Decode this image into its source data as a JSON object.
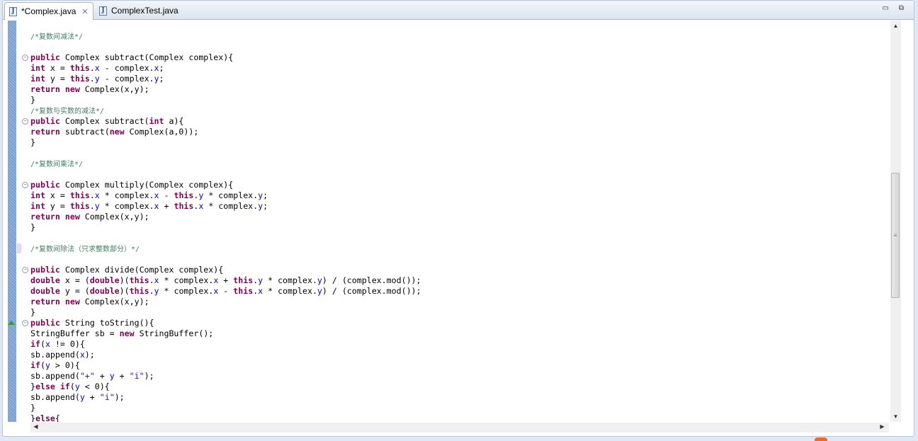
{
  "tabs": [
    {
      "label": "*Complex.java",
      "active": true,
      "icon": "java-file-icon"
    },
    {
      "label": "ComplexTest.java",
      "active": false,
      "icon": "java-file-icon"
    }
  ],
  "window_controls": {
    "minimize": "▭",
    "maximize": "⧉"
  },
  "colors": {
    "keyword": "#7f0055",
    "field": "#0000c0",
    "string": "#2a00ff",
    "comment": "#3f7f5f"
  },
  "scroll": {
    "vertical_position_percent": 41
  },
  "code_lines": [
    [],
    [
      [
        "c",
        "/*复数间减法*/"
      ]
    ],
    [],
    [
      [
        "k",
        "public"
      ],
      [
        "p",
        " Complex subtract(Complex complex){"
      ]
    ],
    [
      [
        "k",
        "int"
      ],
      [
        "p",
        " x = "
      ],
      [
        "k",
        "this"
      ],
      [
        "p",
        "."
      ],
      [
        "f",
        "x"
      ],
      [
        "p",
        " - complex."
      ],
      [
        "f",
        "x"
      ],
      [
        "p",
        ";"
      ]
    ],
    [
      [
        "k",
        "int"
      ],
      [
        "p",
        " y = "
      ],
      [
        "k",
        "this"
      ],
      [
        "p",
        "."
      ],
      [
        "f",
        "y"
      ],
      [
        "p",
        " - complex."
      ],
      [
        "f",
        "y"
      ],
      [
        "p",
        ";"
      ]
    ],
    [
      [
        "k",
        "return"
      ],
      [
        "p",
        " "
      ],
      [
        "k",
        "new"
      ],
      [
        "p",
        " Complex(x,y);"
      ]
    ],
    [
      [
        "p",
        "}"
      ]
    ],
    [
      [
        "c",
        "/*复数与实数的减法*/"
      ]
    ],
    [
      [
        "k",
        "public"
      ],
      [
        "p",
        " Complex subtract("
      ],
      [
        "k",
        "int"
      ],
      [
        "p",
        " a){"
      ]
    ],
    [
      [
        "k",
        "return"
      ],
      [
        "p",
        " subtract("
      ],
      [
        "k",
        "new"
      ],
      [
        "p",
        " Complex(a,0));"
      ]
    ],
    [
      [
        "p",
        "}"
      ]
    ],
    [],
    [
      [
        "c",
        "/*复数间乘法*/"
      ]
    ],
    [],
    [
      [
        "k",
        "public"
      ],
      [
        "p",
        " Complex multiply(Complex complex){"
      ]
    ],
    [
      [
        "k",
        "int"
      ],
      [
        "p",
        " x = "
      ],
      [
        "k",
        "this"
      ],
      [
        "p",
        "."
      ],
      [
        "f",
        "x"
      ],
      [
        "p",
        " * complex."
      ],
      [
        "f",
        "x"
      ],
      [
        "p",
        " - "
      ],
      [
        "k",
        "this"
      ],
      [
        "p",
        "."
      ],
      [
        "f",
        "y"
      ],
      [
        "p",
        " * complex."
      ],
      [
        "f",
        "y"
      ],
      [
        "p",
        ";"
      ]
    ],
    [
      [
        "k",
        "int"
      ],
      [
        "p",
        " y = "
      ],
      [
        "k",
        "this"
      ],
      [
        "p",
        "."
      ],
      [
        "f",
        "y"
      ],
      [
        "p",
        " * complex."
      ],
      [
        "f",
        "x"
      ],
      [
        "p",
        " + "
      ],
      [
        "k",
        "this"
      ],
      [
        "p",
        "."
      ],
      [
        "f",
        "x"
      ],
      [
        "p",
        " * complex."
      ],
      [
        "f",
        "y"
      ],
      [
        "p",
        ";"
      ]
    ],
    [
      [
        "k",
        "return"
      ],
      [
        "p",
        " "
      ],
      [
        "k",
        "new"
      ],
      [
        "p",
        " Complex(x,y);"
      ]
    ],
    [
      [
        "p",
        "}"
      ]
    ],
    [],
    [
      [
        "c",
        "/*复数间除法（只求整数部分）*/"
      ]
    ],
    [],
    [
      [
        "k",
        "public"
      ],
      [
        "p",
        " Complex divide(Complex complex){"
      ]
    ],
    [
      [
        "k",
        "double"
      ],
      [
        "p",
        " x = ("
      ],
      [
        "k",
        "double"
      ],
      [
        "p",
        ")("
      ],
      [
        "k",
        "this"
      ],
      [
        "p",
        "."
      ],
      [
        "f",
        "x"
      ],
      [
        "p",
        " * complex."
      ],
      [
        "f",
        "x"
      ],
      [
        "p",
        " + "
      ],
      [
        "k",
        "this"
      ],
      [
        "p",
        "."
      ],
      [
        "f",
        "y"
      ],
      [
        "p",
        " * complex."
      ],
      [
        "f",
        "y"
      ],
      [
        "p",
        ") / (complex.mod());"
      ]
    ],
    [
      [
        "k",
        "double"
      ],
      [
        "p",
        " y = ("
      ],
      [
        "k",
        "double"
      ],
      [
        "p",
        ")("
      ],
      [
        "k",
        "this"
      ],
      [
        "p",
        "."
      ],
      [
        "f",
        "y"
      ],
      [
        "p",
        " * complex."
      ],
      [
        "f",
        "x"
      ],
      [
        "p",
        " - "
      ],
      [
        "k",
        "this"
      ],
      [
        "p",
        "."
      ],
      [
        "f",
        "x"
      ],
      [
        "p",
        " * complex."
      ],
      [
        "f",
        "y"
      ],
      [
        "p",
        ") / (complex.mod());"
      ]
    ],
    [
      [
        "k",
        "return"
      ],
      [
        "p",
        " "
      ],
      [
        "k",
        "new"
      ],
      [
        "p",
        " Complex(x,y);"
      ]
    ],
    [
      [
        "p",
        "}"
      ]
    ],
    [
      [
        "k",
        "public"
      ],
      [
        "p",
        " String toString(){"
      ]
    ],
    [
      [
        "p",
        "StringBuffer sb = "
      ],
      [
        "k",
        "new"
      ],
      [
        "p",
        " StringBuffer();"
      ]
    ],
    [
      [
        "k",
        "if"
      ],
      [
        "p",
        "("
      ],
      [
        "f",
        "x"
      ],
      [
        "p",
        " != 0){"
      ]
    ],
    [
      [
        "p",
        "sb.append("
      ],
      [
        "f",
        "x"
      ],
      [
        "p",
        ");"
      ]
    ],
    [
      [
        "k",
        "if"
      ],
      [
        "p",
        "("
      ],
      [
        "f",
        "y"
      ],
      [
        "p",
        " > 0){"
      ]
    ],
    [
      [
        "p",
        "sb.append("
      ],
      [
        "s",
        "\"+\""
      ],
      [
        "p",
        " + "
      ],
      [
        "f",
        "y"
      ],
      [
        "p",
        " + "
      ],
      [
        "s",
        "\"i\""
      ],
      [
        "p",
        ");"
      ]
    ],
    [
      [
        "p",
        "}"
      ],
      [
        "k",
        "else"
      ],
      [
        "p",
        " "
      ],
      [
        "k",
        "if"
      ],
      [
        "p",
        "("
      ],
      [
        "f",
        "y"
      ],
      [
        "p",
        " < 0){"
      ]
    ],
    [
      [
        "p",
        "sb.append("
      ],
      [
        "f",
        "y"
      ],
      [
        "p",
        " + "
      ],
      [
        "s",
        "\"i\""
      ],
      [
        "p",
        ");"
      ]
    ],
    [
      [
        "p",
        "}"
      ]
    ],
    [
      [
        "p",
        "}"
      ],
      [
        "k",
        "else"
      ],
      [
        "p",
        "{"
      ]
    ]
  ]
}
